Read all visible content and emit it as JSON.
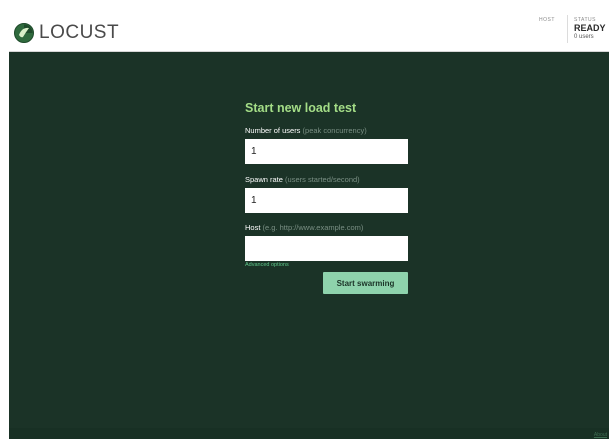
{
  "header": {
    "brand": "LOCUST",
    "host_label": "HOST",
    "status_label": "STATUS",
    "status_value": "READY",
    "users_text": "0 users"
  },
  "form": {
    "title": "Start new load test",
    "users": {
      "label": "Number of users",
      "hint": "(peak concurrency)",
      "value": "1"
    },
    "spawn": {
      "label": "Spawn rate",
      "hint": "(users started/second)",
      "value": "1"
    },
    "host": {
      "label": "Host",
      "hint": "(e.g. http://www.example.com)",
      "value": ""
    },
    "advanced_label": "Advanced options",
    "submit_label": "Start swarming"
  },
  "footer": {
    "link_text": "About"
  },
  "colors": {
    "background": "#1b3327",
    "title": "#a4dd87",
    "button": "#8ed3ac",
    "link": "#5fc88b"
  }
}
